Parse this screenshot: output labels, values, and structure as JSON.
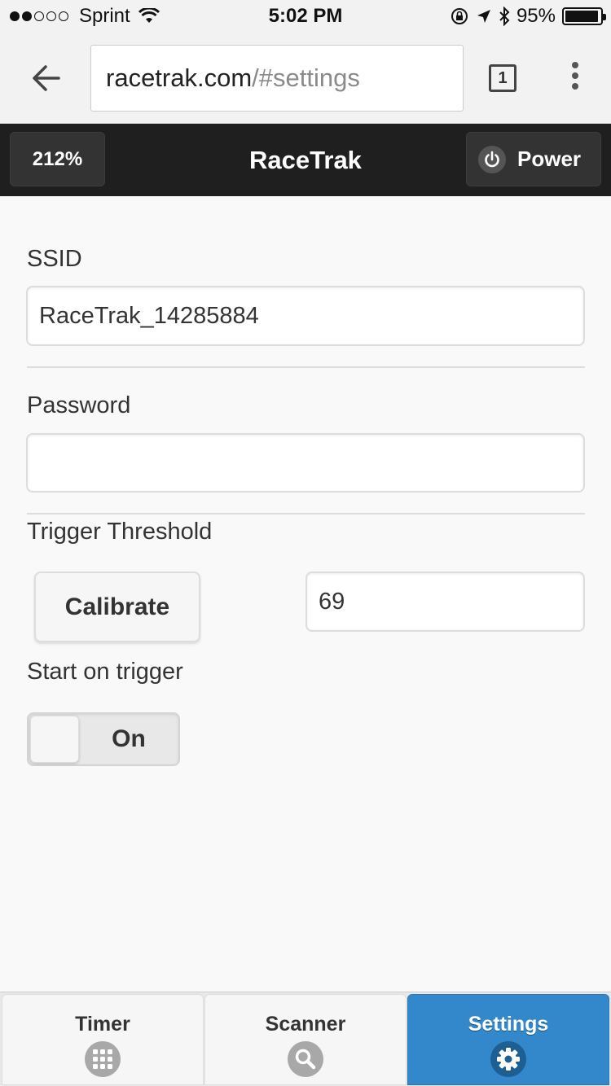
{
  "status_bar": {
    "carrier": "Sprint",
    "time": "5:02 PM",
    "battery": "95%",
    "signal_bars_filled": 2,
    "signal_bars_total": 5
  },
  "browser": {
    "url_host": "racetrak.com",
    "url_path": "/#settings",
    "tab_count": "1",
    "icons": [
      "back-arrow-icon",
      "tabs-icon",
      "overflow-menu-icon"
    ]
  },
  "header": {
    "zoom_label": "212%",
    "title": "RaceTrak",
    "power_label": "Power"
  },
  "settings": {
    "ssid_label": "SSID",
    "ssid_value": "RaceTrak_14285884",
    "password_label": "Password",
    "password_value": "",
    "threshold_label": "Trigger Threshold",
    "calibrate_label": "Calibrate",
    "threshold_value": "69",
    "start_label": "Start on trigger",
    "toggle_label": "On"
  },
  "tabs": [
    {
      "label": "Timer",
      "icon": "grid-icon",
      "active": false
    },
    {
      "label": "Scanner",
      "icon": "search-icon",
      "active": false
    },
    {
      "label": "Settings",
      "icon": "gear-icon",
      "active": true
    }
  ],
  "colors": {
    "header_bg": "#1f1f1f",
    "active_tab": "#3388cc",
    "page_bg": "#f9f9f9"
  }
}
